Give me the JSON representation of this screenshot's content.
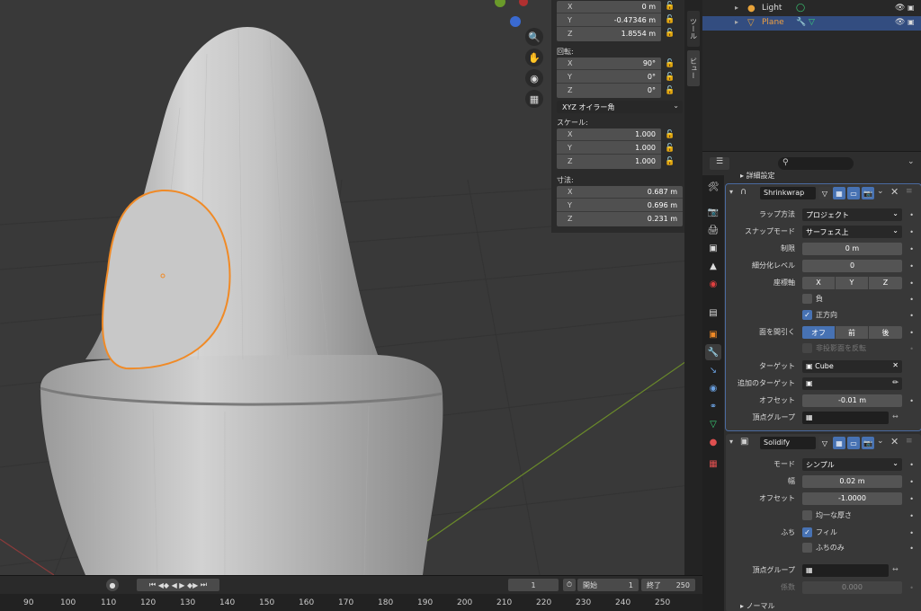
{
  "colors": {
    "accent": "#4772b3",
    "selection_orange": "#f08a26",
    "viewport_bg": "#393939",
    "x_axis": "#8a3a3a",
    "y_axis": "#6a8a2a"
  },
  "viewport": {
    "nav_icons": [
      "zoom-icon",
      "hand-icon",
      "camera-icon",
      "grid-icon"
    ]
  },
  "npanel": {
    "location": {
      "x": "0 m",
      "y": "-0.47346 m",
      "z": "1.8554 m"
    },
    "rotation_label": "回転:",
    "rotation": {
      "x": "90°",
      "y": "0°",
      "z": "0°"
    },
    "rotation_mode": "XYZ オイラー角",
    "scale_label": "スケール:",
    "scale": {
      "x": "1.000",
      "y": "1.000",
      "z": "1.000"
    },
    "dimensions_label": "寸法:",
    "dimensions": {
      "x": "0.687 m",
      "y": "0.696 m",
      "z": "0.231 m"
    },
    "axis": {
      "x": "X",
      "y": "Y",
      "z": "Z"
    }
  },
  "sidetabs": {
    "tool": "ツール",
    "view": "ビュー"
  },
  "outliner": {
    "rows": [
      {
        "name": "Light"
      },
      {
        "name": "Plane"
      }
    ]
  },
  "timeline": {
    "current_frame": "1",
    "start_label": "開始",
    "start_value": "1",
    "end_label": "終了",
    "end_value": "250",
    "ticks": [
      "90",
      "100",
      "110",
      "120",
      "130",
      "140",
      "150",
      "160",
      "170",
      "180",
      "190",
      "200",
      "210",
      "220",
      "230",
      "240",
      "250"
    ]
  },
  "props": {
    "section_label": "詳細設定",
    "shrinkwrap": {
      "name": "Shrinkwrap",
      "wrap_method_label": "ラップ方法",
      "wrap_method": "プロジェクト",
      "snap_mode_label": "スナップモード",
      "snap_mode": "サーフェス上",
      "limit_label": "制限",
      "limit": "0 m",
      "subdiv_label": "細分化レベル",
      "subdiv": "0",
      "axis_label": "座標軸",
      "axis_x": "X",
      "axis_y": "Y",
      "axis_z": "Z",
      "negative_label": "負",
      "positive_label": "正方向",
      "cull_label": "面を間引く",
      "cull_off": "オフ",
      "cull_front": "前",
      "cull_back": "後",
      "invert_cull_label": "非投影面を反転",
      "target_label": "ターゲット",
      "target": "Cube",
      "aux_target_label": "追加のターゲット",
      "offset_label": "オフセット",
      "offset": "-0.01 m",
      "vgroup_label": "頂点グループ"
    },
    "solidify": {
      "name": "Solidify",
      "mode_label": "モード",
      "mode": "シンプル",
      "thickness_label": "幅",
      "thickness": "0.02 m",
      "offset_label": "オフセット",
      "offset": "-1.0000",
      "even_label": "均一な厚さ",
      "rim_label": "ふち",
      "fill_label": "フィル",
      "rim_only_label": "ふちのみ",
      "vgroup_label": "頂点グループ",
      "factor_label": "係数",
      "factor": "0.000",
      "normals_label": "ノーマル"
    }
  }
}
